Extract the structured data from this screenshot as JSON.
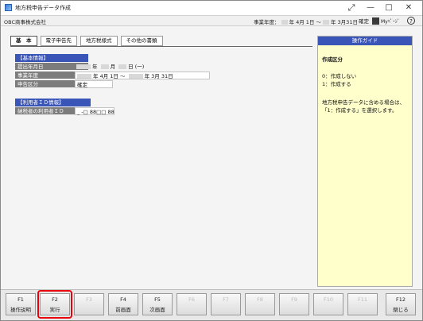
{
  "window": {
    "title": "地方税申告データ作成",
    "minimize": "—",
    "maximize": "□",
    "close": "✕"
  },
  "infobar": {
    "company": "OBC商事株式会社",
    "fiscal": "事業年度：",
    "fiscal_start": "年 4月 1日 ～",
    "fiscal_end": "年 3月31日",
    "confirm": "確定",
    "mypage": "Myﾍﾟｰｼﾞ",
    "help": "?"
  },
  "tabs": [
    "基　本",
    "電子申告先",
    "地方税様式",
    "その他の書類"
  ],
  "basic": {
    "header": "【基本情報】",
    "rows": [
      {
        "label": "提出年月日",
        "value_parts": [
          "年",
          "月",
          "日",
          "(一)"
        ]
      },
      {
        "label": "事業年度",
        "value_parts": [
          "年 4月 1日 ～",
          "年 3月 31日"
        ]
      },
      {
        "label": "申告区分",
        "value": "確定"
      }
    ]
  },
  "user_id": {
    "header": "【利用者ＩＤ情報】",
    "label": "納税者の利用者ＩＤ",
    "value": "_ -□ 88□□ 88"
  },
  "guide": {
    "header": "操作ガイド",
    "title": "作成区分",
    "option0": "0：作成しない",
    "option1": "1：作成する",
    "description": "地方税申告データに含める場合は、「1：作成する」を選択します。"
  },
  "fkeys": [
    {
      "key": "F1",
      "label": "操作説明",
      "enabled": true
    },
    {
      "key": "F2",
      "label": "実行",
      "enabled": true
    },
    {
      "key": "F3",
      "label": "",
      "enabled": false
    },
    {
      "key": "F4",
      "label": "前画面",
      "enabled": true
    },
    {
      "key": "F5",
      "label": "次画面",
      "enabled": true
    },
    {
      "key": "F6",
      "label": "",
      "enabled": false
    },
    {
      "key": "F7",
      "label": "",
      "enabled": false
    },
    {
      "key": "F8",
      "label": "",
      "enabled": false
    },
    {
      "key": "F9",
      "label": "",
      "enabled": false
    },
    {
      "key": "F10",
      "label": "",
      "enabled": false
    },
    {
      "key": "F11",
      "label": "",
      "enabled": false
    },
    {
      "key": "F12",
      "label": "閉じる",
      "enabled": true
    }
  ],
  "colors": {
    "section_header": "#3a55b8",
    "label_bg": "#7c7c7c",
    "guide_bg": "#ffffcc",
    "highlight": "#e8000b"
  }
}
